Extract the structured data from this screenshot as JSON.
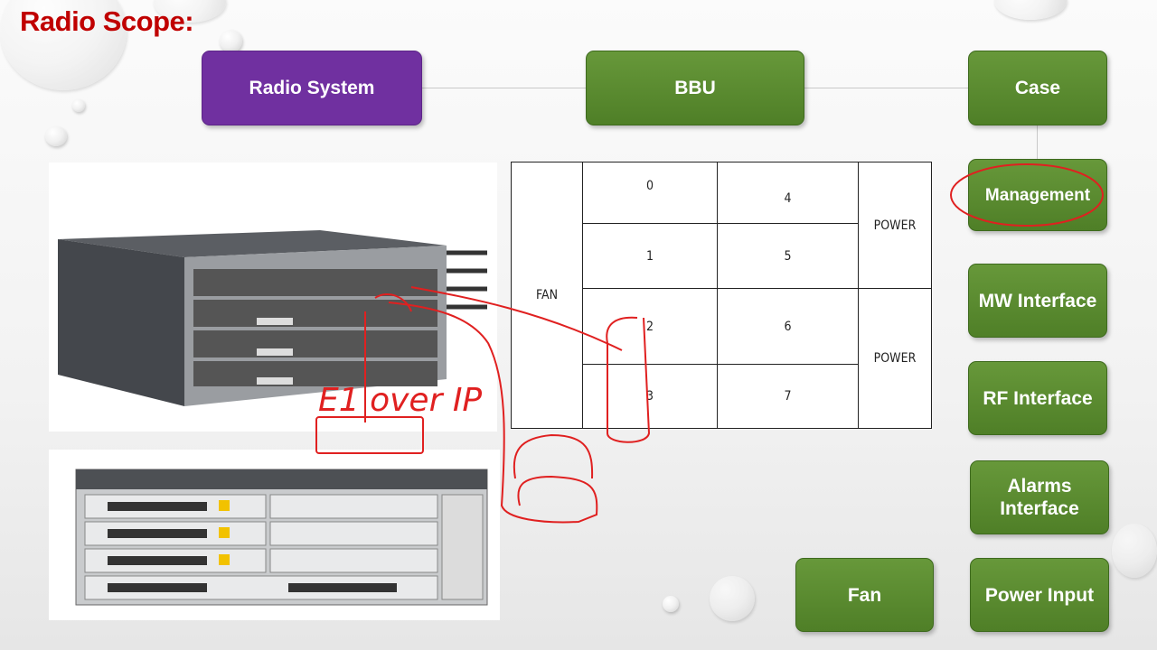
{
  "slide": {
    "title": "Radio Scope:"
  },
  "nodes": {
    "radio_system": "Radio System",
    "bbu": "BBU",
    "case": "Case",
    "management": "Management",
    "mw_interface": "MW Interface",
    "rf_interface": "RF Interface",
    "alarms_interface": "Alarms Interface",
    "fan": "Fan",
    "power_input": "Power Input"
  },
  "slot_table": {
    "fan": "FAN",
    "slots": [
      "0",
      "1",
      "2",
      "3",
      "4",
      "5",
      "6",
      "7"
    ],
    "power_top": "POWER",
    "power_bottom": "POWER"
  },
  "annotation": {
    "text": "E1 over IP",
    "color": "#e02020"
  },
  "colors": {
    "title": "#c00000",
    "purple": "#7030a0",
    "green": "#5a8a2e"
  }
}
